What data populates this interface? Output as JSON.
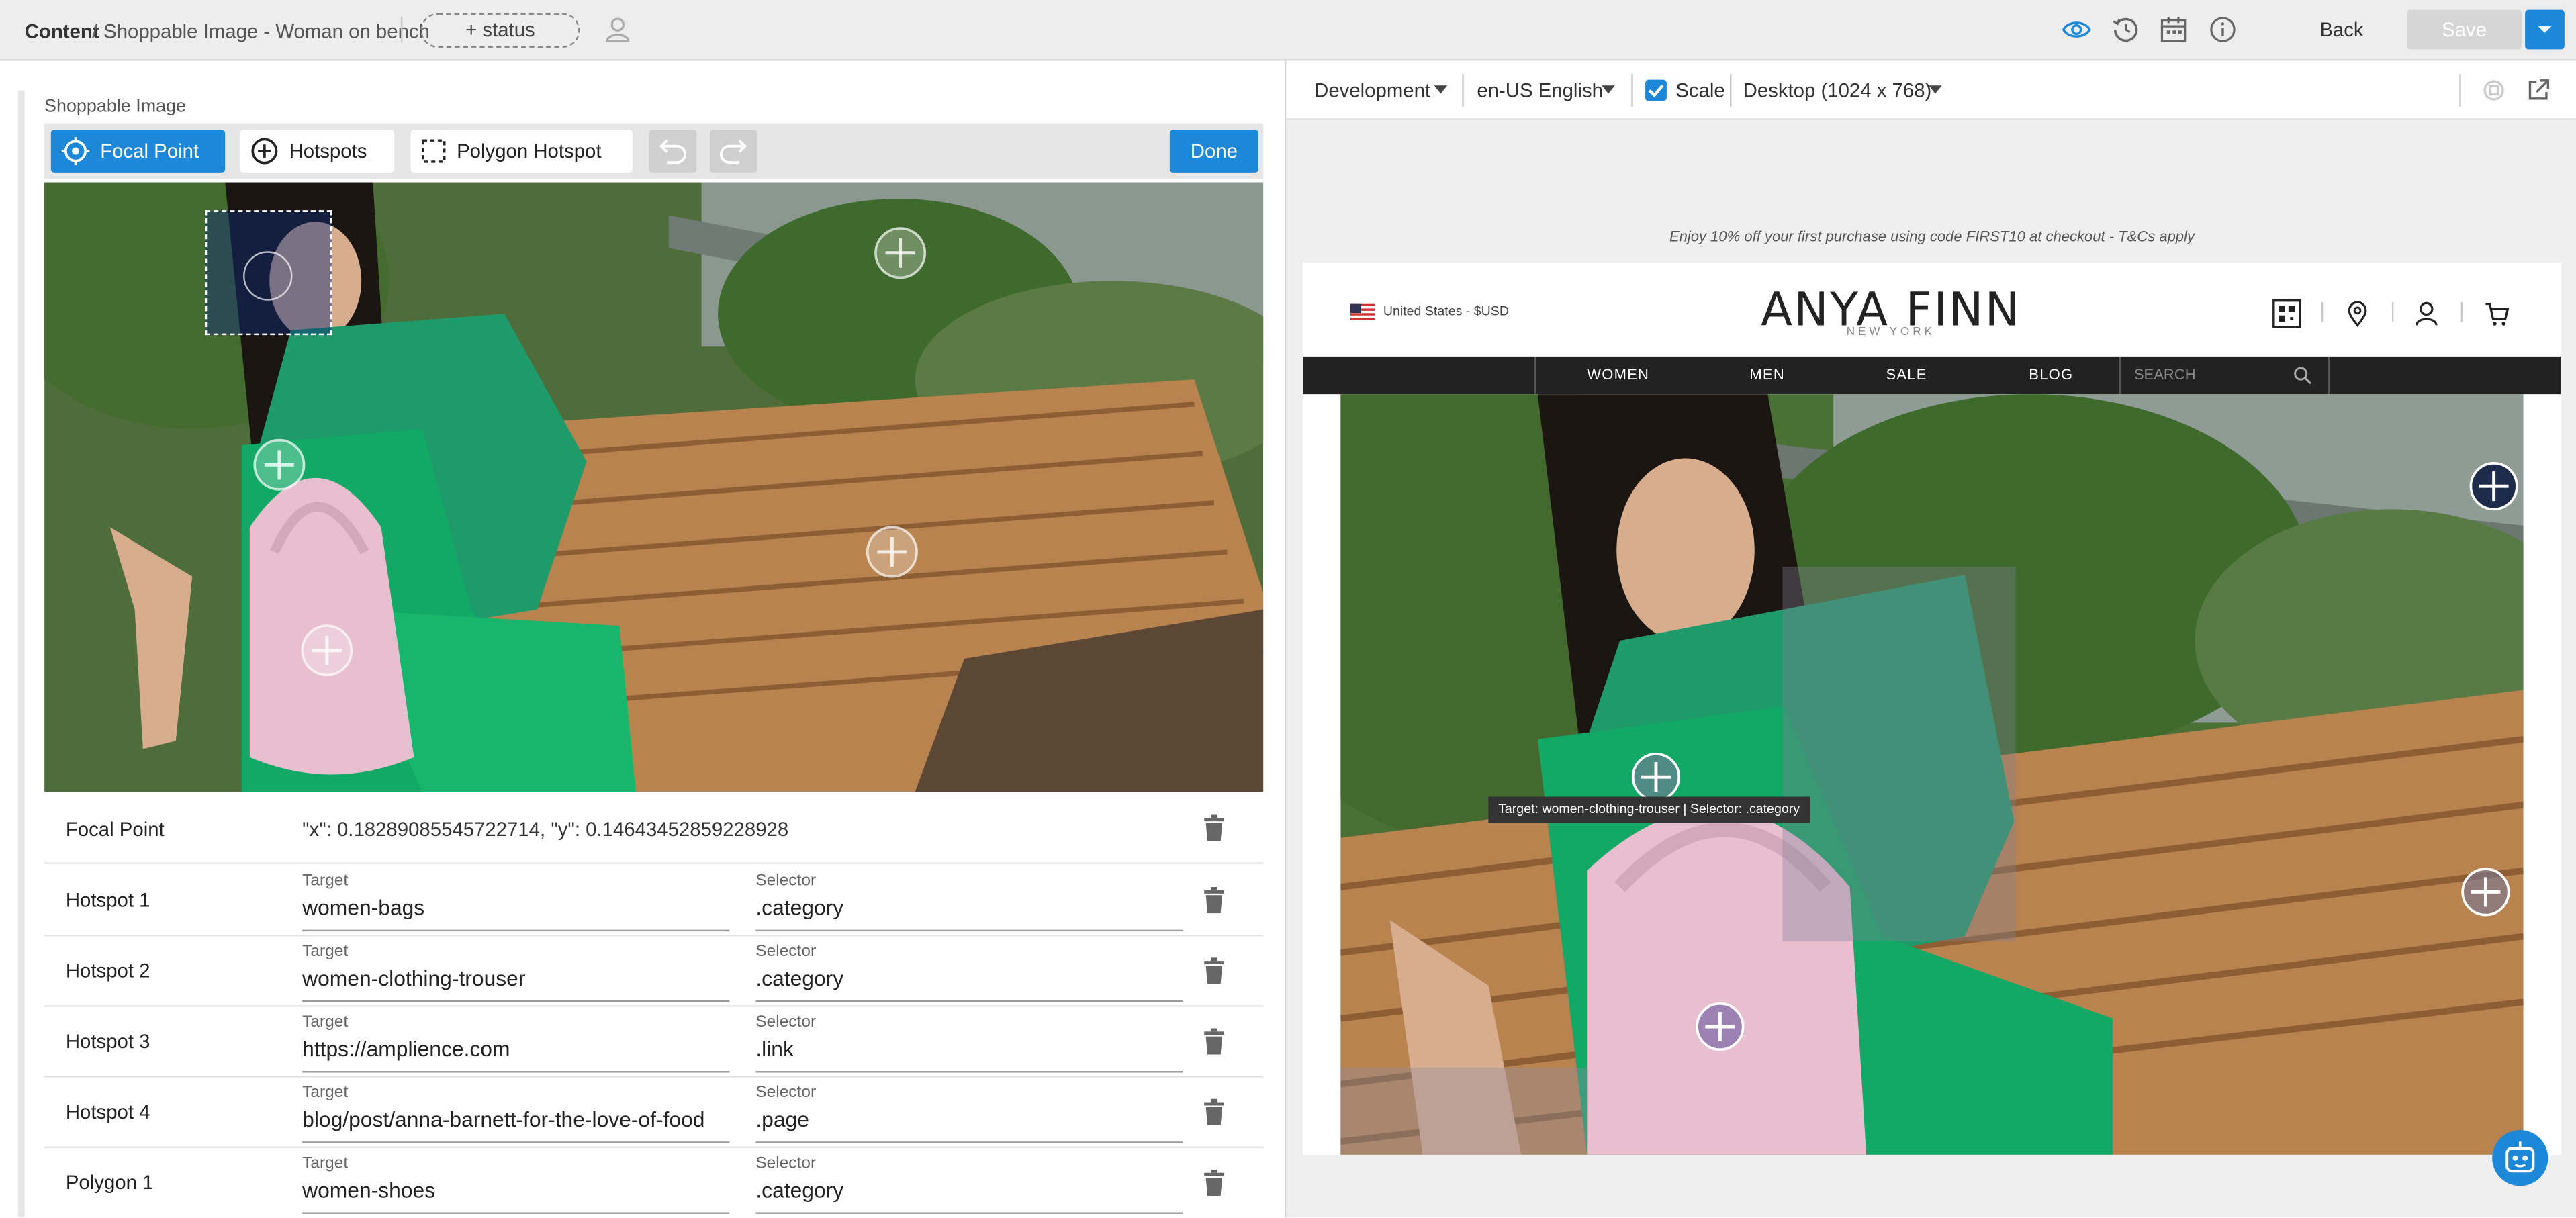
{
  "topbar": {
    "breadcrumb_root": "Content",
    "breadcrumb_sep": "/",
    "breadcrumb_page": "Shoppable Image - Woman on bench",
    "status_label": "+ status",
    "back_label": "Back",
    "save_label": "Save",
    "icons": [
      "user-icon",
      "visibility-icon",
      "history-icon",
      "calendar-icon",
      "info-icon",
      "dropdown-arrow-icon"
    ]
  },
  "editor": {
    "title": "Shoppable Image",
    "tools": {
      "focal_point": "Focal Point",
      "hotspots": "Hotspots",
      "polygon_hotspot": "Polygon Hotspot",
      "done": "Done"
    },
    "focal_point": {
      "name": "Focal Point",
      "value": "\"x\": 0.18289085545722714, \"y\": 0.14643452859228928"
    },
    "target_label": "Target",
    "selector_label": "Selector",
    "hotspots": [
      {
        "name": "Hotspot 1",
        "target": "women-bags",
        "selector": ".category"
      },
      {
        "name": "Hotspot 2",
        "target": "women-clothing-trouser",
        "selector": ".category"
      },
      {
        "name": "Hotspot 3",
        "target": "https://amplience.com",
        "selector": ".link"
      },
      {
        "name": "Hotspot 4",
        "target": "blog/post/anna-barnett-for-the-love-of-food",
        "selector": ".page"
      },
      {
        "name": "Polygon 1",
        "target": "women-shoes",
        "selector": ".category"
      }
    ]
  },
  "preview": {
    "environment": "Development",
    "locale": "en-US English",
    "scale_label": "Scale",
    "scale_checked": true,
    "device": "Desktop (1024 x 768)",
    "site": {
      "promo": "Enjoy 10% off your first purchase using code FIRST10 at checkout - T&Cs apply",
      "locale": "United States - $USD",
      "brand": "ANYA FINN",
      "brand_sub": "NEW YORK",
      "nav": [
        "WOMEN",
        "MEN",
        "SALE",
        "BLOG"
      ],
      "search_placeholder": "SEARCH"
    },
    "tooltip": "Target: women-clothing-trouser | Selector: .category"
  },
  "colors": {
    "accent": "#1c88d7",
    "navbar": "#222222",
    "bench": "#b07a4a",
    "dress": "#1f9a6b"
  }
}
